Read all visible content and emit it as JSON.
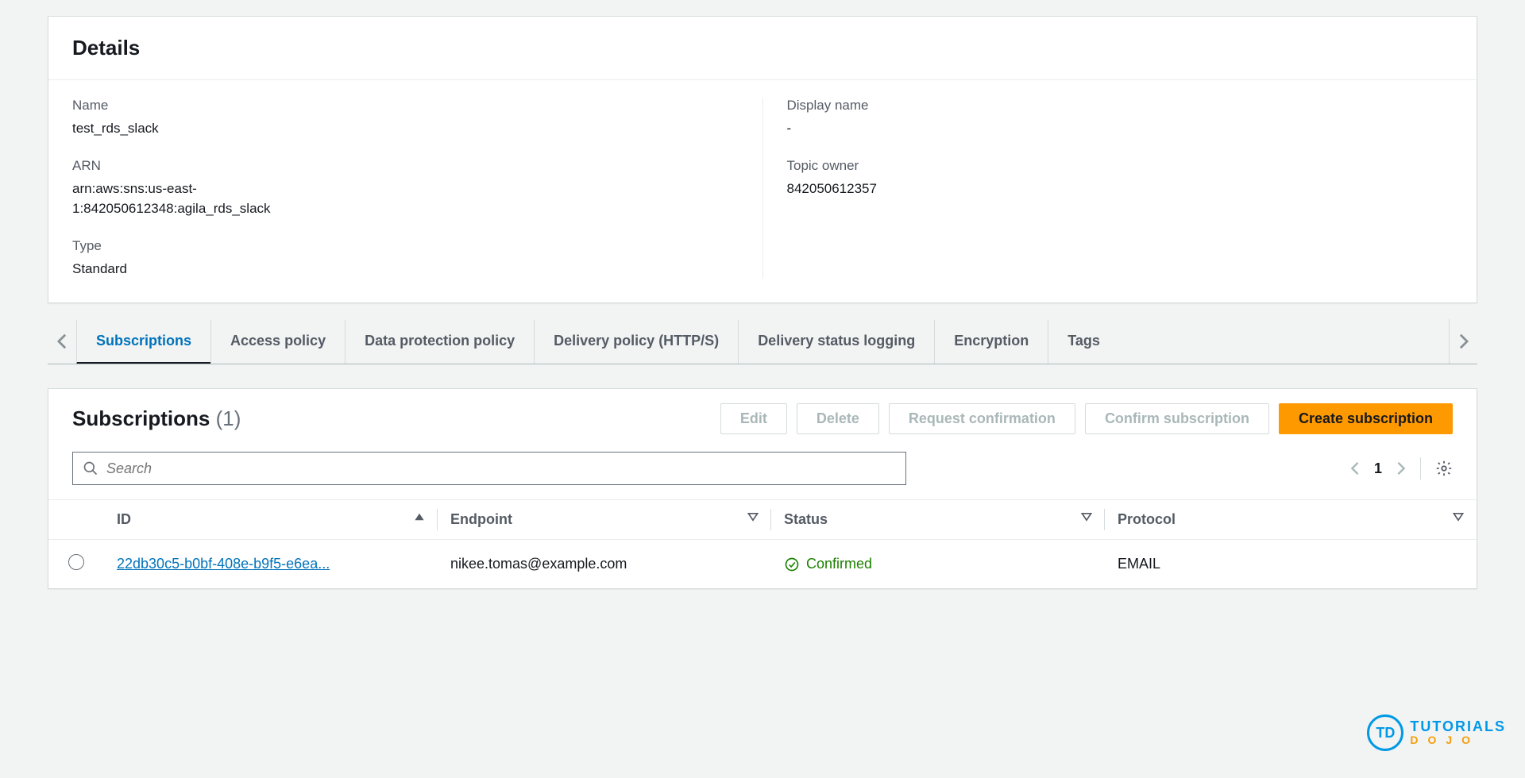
{
  "details": {
    "title": "Details",
    "name_label": "Name",
    "name_value": "test_rds_slack",
    "arn_label": "ARN",
    "arn_value": "arn:aws:sns:us-east-1:842050612348:agila_rds_slack",
    "type_label": "Type",
    "type_value": "Standard",
    "display_name_label": "Display name",
    "display_name_value": "-",
    "topic_owner_label": "Topic owner",
    "topic_owner_value": "842050612357"
  },
  "tabs": {
    "items": [
      "Subscriptions",
      "Access policy",
      "Data protection policy",
      "Delivery policy (HTTP/S)",
      "Delivery status logging",
      "Encryption",
      "Tags"
    ],
    "active_index": 0
  },
  "subscriptions": {
    "title": "Subscriptions",
    "count_display": "(1)",
    "actions": {
      "edit": "Edit",
      "delete": "Delete",
      "request_confirmation": "Request confirmation",
      "confirm_subscription": "Confirm subscription",
      "create_subscription": "Create subscription"
    },
    "search_placeholder": "Search",
    "pagination": {
      "current": "1"
    },
    "columns": {
      "id": "ID",
      "endpoint": "Endpoint",
      "status": "Status",
      "protocol": "Protocol"
    },
    "rows": [
      {
        "id": "22db30c5-b0bf-408e-b9f5-e6ea...",
        "endpoint": "nikee.tomas@example.com",
        "status": "Confirmed",
        "protocol": "EMAIL"
      }
    ]
  },
  "watermark": {
    "badge": "TD",
    "line1": "TUTORIALS",
    "line2": "DOJO"
  }
}
